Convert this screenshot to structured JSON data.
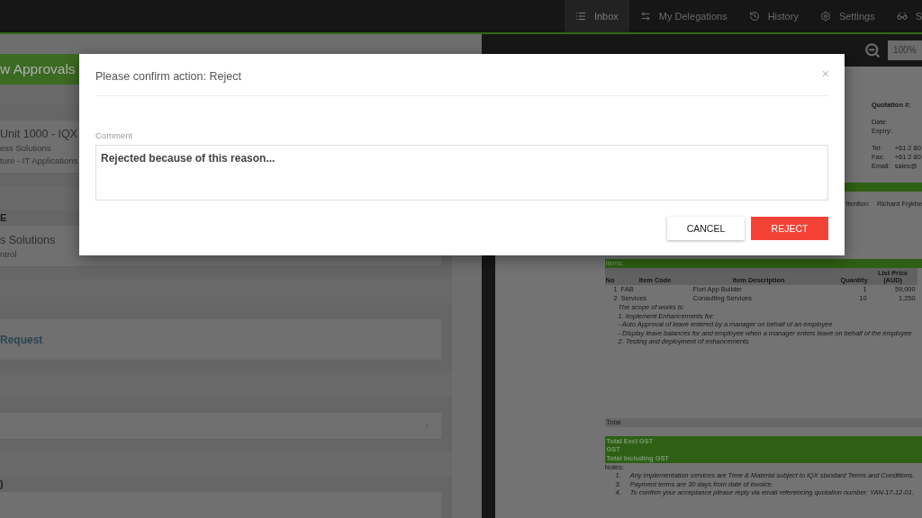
{
  "nav": {
    "items": [
      {
        "label": "Inbox",
        "selected": true
      },
      {
        "label": "My Delegations",
        "selected": false
      },
      {
        "label": "History",
        "selected": false
      },
      {
        "label": "Settings",
        "selected": false
      },
      {
        "label": "S",
        "selected": false
      }
    ]
  },
  "left_panel": {
    "title": "w Approvals",
    "groups": [
      {
        "card": {
          "lines": [
            {
              "text": "Unit 1000 - IQX",
              "kind": "title"
            },
            {
              "text": "ess Solutions",
              "kind": "sub"
            },
            {
              "text": "ture - IT Applications",
              "kind": "sub"
            }
          ]
        }
      },
      {
        "heading": "E",
        "card": {
          "lines": [
            {
              "text": "s Solutions",
              "kind": "title"
            },
            {
              "text": "ntrol",
              "kind": "sub"
            }
          ]
        }
      },
      {
        "card": {
          "lines": [
            {
              "text": "Request",
              "kind": "link"
            }
          ]
        }
      },
      {
        "card": {
          "chevron": true
        }
      },
      {
        "heading": ")"
      }
    ]
  },
  "viewer": {
    "zoom_value": "100%"
  },
  "document": {
    "quotation_label": "Quotation #:",
    "dates": [
      "Date:",
      "Expiry:"
    ],
    "contacts": [
      {
        "label": "Tel:",
        "value": "+61 2 80"
      },
      {
        "label": "Fax:",
        "value": "+61 2 80"
      },
      {
        "label": "Email:",
        "value": "sales@"
      }
    ],
    "attention": {
      "label": "ttention:",
      "value": "Richard Frykbe"
    },
    "items_heading": "Items:",
    "columns": [
      "No",
      "Item Code",
      "Item Description",
      "Quantity",
      "List Price (AUD)"
    ],
    "rows": [
      [
        "1",
        "FAB",
        "Fiori App Builder",
        "1",
        "59,000"
      ],
      [
        "2",
        "Services",
        "Consulting Services",
        "10",
        "1,250"
      ]
    ],
    "scope_lines": [
      "The scope of works is:",
      "1. Implement Enhancements for:",
      "-  Auto Approval of leave entered by a manager on behalf of an employee",
      "-  Display leave balances for and employee when a manager enters leave on behalf of the employee",
      "2.  Testing and deployment of enhancements"
    ],
    "total_label": "Total",
    "totals": [
      "Total Excl GST",
      "GST",
      "Total Including GST"
    ],
    "notes_heading": "Notes:",
    "notes": [
      {
        "number": "1.",
        "text": "Any implementation services are Time & Material subject to IQX standard Terms and Conditions."
      },
      {
        "number": "3.",
        "text": "Payment terms are 30 days from date of invoice."
      },
      {
        "number": "4.",
        "text": "To confirm your acceptance please reply via email referencing quotation number: YAN-17-12-01."
      }
    ]
  },
  "dialog": {
    "title": "Please confirm action: Reject",
    "close": "×",
    "comment_label": "Comment",
    "comment_value": "Rejected because of this reason...",
    "buttons": [
      {
        "label": "CANCEL",
        "kind": "secondary"
      },
      {
        "label": "REJECT",
        "kind": "danger"
      }
    ]
  }
}
